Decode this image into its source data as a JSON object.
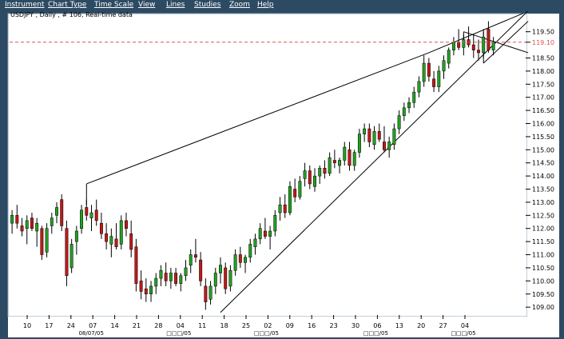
{
  "menu": {
    "items": [
      {
        "label": "Instrument",
        "key": "instrument"
      },
      {
        "label": "Chart Type",
        "key": "chart-type"
      },
      {
        "label": "Time Scale",
        "key": "time-scale"
      },
      {
        "label": "View",
        "key": "view"
      },
      {
        "label": "Lines",
        "key": "lines"
      },
      {
        "label": "Studies",
        "key": "studies"
      },
      {
        "label": "Zoom",
        "key": "zoom"
      },
      {
        "label": "Help",
        "key": "help"
      }
    ]
  },
  "colors": {
    "frame": "#2d4a63",
    "plot_bg": "#ffffff",
    "up_candle": "#22a022",
    "down_candle": "#c01818",
    "wick": "#000000",
    "trendline": "#000000",
    "price_line": "#e05050",
    "grid": "#c8c8c8"
  },
  "chart_data": {
    "type": "candlestick",
    "title": "USDJPY , Daily , # 106, Real-time data",
    "current_price": "119.10",
    "y_ticks": [
      "119.50",
      "119.10",
      "118.50",
      "118.00",
      "117.50",
      "117.00",
      "116.50",
      "116.00",
      "115.50",
      "115.00",
      "114.50",
      "114.00",
      "113.50",
      "113.00",
      "112.50",
      "112.00",
      "111.50",
      "111.00",
      "110.50",
      "110.00",
      "109.50",
      "109.00"
    ],
    "ylim": [
      108.7,
      120.1
    ],
    "x_ticks": [
      "10",
      "17",
      "24",
      "07",
      "14",
      "21",
      "28",
      "04",
      "11",
      "18",
      "25",
      "02",
      "09",
      "16",
      "23",
      "30",
      "06",
      "13",
      "20",
      "27",
      "04"
    ],
    "x_sublabels": [
      {
        "after_tick": 3,
        "label": "08/07/05"
      },
      {
        "after_tick": 7,
        "label": "□□□/05"
      },
      {
        "after_tick": 11,
        "label": "□□□/05"
      },
      {
        "after_tick": 16,
        "label": "□□□/05"
      },
      {
        "after_tick": 20,
        "label": "□□□/05"
      }
    ],
    "candles": [
      [
        112.2,
        112.7,
        111.8,
        112.5
      ],
      [
        112.5,
        112.9,
        112.0,
        112.2
      ],
      [
        112.1,
        112.4,
        111.7,
        111.9
      ],
      [
        112.0,
        112.5,
        111.4,
        112.3
      ],
      [
        112.4,
        112.6,
        111.9,
        112.0
      ],
      [
        111.9,
        112.4,
        111.3,
        112.2
      ],
      [
        112.0,
        112.1,
        110.8,
        111.0
      ],
      [
        111.1,
        112.2,
        110.9,
        112.0
      ],
      [
        112.1,
        112.6,
        111.8,
        112.4
      ],
      [
        112.5,
        113.0,
        112.2,
        112.8
      ],
      [
        113.1,
        113.3,
        111.9,
        112.1
      ],
      [
        112.0,
        112.3,
        109.8,
        110.2
      ],
      [
        110.5,
        111.6,
        110.3,
        111.4
      ],
      [
        111.5,
        112.1,
        111.0,
        111.9
      ],
      [
        112.0,
        112.9,
        111.8,
        112.7
      ],
      [
        112.8,
        113.1,
        112.3,
        112.5
      ],
      [
        112.4,
        112.9,
        111.9,
        112.6
      ],
      [
        112.7,
        113.1,
        112.1,
        112.3
      ],
      [
        112.2,
        112.6,
        111.6,
        111.8
      ],
      [
        111.8,
        112.2,
        111.2,
        111.5
      ],
      [
        111.4,
        112.0,
        110.9,
        111.7
      ],
      [
        111.6,
        112.2,
        111.2,
        111.3
      ],
      [
        111.4,
        112.5,
        111.2,
        112.3
      ],
      [
        112.3,
        112.6,
        111.7,
        112.0
      ],
      [
        111.8,
        112.3,
        110.9,
        111.2
      ],
      [
        111.3,
        111.6,
        109.6,
        109.9
      ],
      [
        110.0,
        110.4,
        109.3,
        109.6
      ],
      [
        109.7,
        110.1,
        109.2,
        109.5
      ],
      [
        109.5,
        110.0,
        109.2,
        109.8
      ],
      [
        109.8,
        110.3,
        109.5,
        110.1
      ],
      [
        110.1,
        110.6,
        109.8,
        110.4
      ],
      [
        110.3,
        110.7,
        109.8,
        110.0
      ],
      [
        110.0,
        110.5,
        109.7,
        110.3
      ],
      [
        110.3,
        110.5,
        109.8,
        109.9
      ],
      [
        109.9,
        110.3,
        109.6,
        110.2
      ],
      [
        110.2,
        110.8,
        110.0,
        110.5
      ],
      [
        110.6,
        111.2,
        110.3,
        111.0
      ],
      [
        111.0,
        111.6,
        110.7,
        110.9
      ],
      [
        110.8,
        111.1,
        109.8,
        110.0
      ],
      [
        109.8,
        110.1,
        108.9,
        109.2
      ],
      [
        109.3,
        110.0,
        109.1,
        109.8
      ],
      [
        109.8,
        110.5,
        109.5,
        110.3
      ],
      [
        110.3,
        110.9,
        109.9,
        110.6
      ],
      [
        110.5,
        110.7,
        109.5,
        109.7
      ],
      [
        109.8,
        110.6,
        109.6,
        110.4
      ],
      [
        110.4,
        111.2,
        110.2,
        111.0
      ],
      [
        111.0,
        111.3,
        110.5,
        110.7
      ],
      [
        110.7,
        111.0,
        110.3,
        110.9
      ],
      [
        110.9,
        111.6,
        110.7,
        111.4
      ],
      [
        111.3,
        111.8,
        111.0,
        111.6
      ],
      [
        111.6,
        112.2,
        111.4,
        112.0
      ],
      [
        111.9,
        112.4,
        111.6,
        111.7
      ],
      [
        111.7,
        112.1,
        111.2,
        111.9
      ],
      [
        111.9,
        112.7,
        111.7,
        112.5
      ],
      [
        112.6,
        113.2,
        112.3,
        112.9
      ],
      [
        112.9,
        113.3,
        112.4,
        112.6
      ],
      [
        112.6,
        113.8,
        112.5,
        113.6
      ],
      [
        113.5,
        113.9,
        113.0,
        113.2
      ],
      [
        113.2,
        114.0,
        113.1,
        113.8
      ],
      [
        113.9,
        114.5,
        113.6,
        114.2
      ],
      [
        114.2,
        114.4,
        113.5,
        113.7
      ],
      [
        113.6,
        114.3,
        113.4,
        114.0
      ],
      [
        114.0,
        114.4,
        113.7,
        114.3
      ],
      [
        114.3,
        114.6,
        113.9,
        114.1
      ],
      [
        114.1,
        114.9,
        114.0,
        114.7
      ],
      [
        114.6,
        115.0,
        114.3,
        114.5
      ],
      [
        114.4,
        114.7,
        114.1,
        114.6
      ],
      [
        114.6,
        115.3,
        114.4,
        115.1
      ],
      [
        115.0,
        115.3,
        114.2,
        114.4
      ],
      [
        114.4,
        115.0,
        114.2,
        114.9
      ],
      [
        114.9,
        115.8,
        114.7,
        115.6
      ],
      [
        115.6,
        116.0,
        115.3,
        115.8
      ],
      [
        115.8,
        116.0,
        115.1,
        115.3
      ],
      [
        115.2,
        115.9,
        115.0,
        115.7
      ],
      [
        115.7,
        116.0,
        115.3,
        115.4
      ],
      [
        115.3,
        115.9,
        114.9,
        115.0
      ],
      [
        115.0,
        115.5,
        114.7,
        115.3
      ],
      [
        115.2,
        116.0,
        115.0,
        115.8
      ],
      [
        115.8,
        116.5,
        115.6,
        116.3
      ],
      [
        116.3,
        116.8,
        116.1,
        116.6
      ],
      [
        116.6,
        117.0,
        116.4,
        116.8
      ],
      [
        116.8,
        117.4,
        116.6,
        117.2
      ],
      [
        117.2,
        117.8,
        117.0,
        117.6
      ],
      [
        117.6,
        118.6,
        117.4,
        118.3
      ],
      [
        118.3,
        118.5,
        117.6,
        117.8
      ],
      [
        117.7,
        118.0,
        117.2,
        117.4
      ],
      [
        117.4,
        118.2,
        117.2,
        118.0
      ],
      [
        118.0,
        118.6,
        117.7,
        118.4
      ],
      [
        118.3,
        118.9,
        118.1,
        118.8
      ],
      [
        118.8,
        119.3,
        118.6,
        119.1
      ],
      [
        119.1,
        119.6,
        118.8,
        118.9
      ],
      [
        118.9,
        119.4,
        118.6,
        119.2
      ],
      [
        119.2,
        119.7,
        118.9,
        119.0
      ],
      [
        119.0,
        119.4,
        118.5,
        118.8
      ],
      [
        118.8,
        119.2,
        118.4,
        118.7
      ],
      [
        118.7,
        119.5,
        118.5,
        119.3
      ],
      [
        119.6,
        119.9,
        118.7,
        118.8
      ],
      [
        118.8,
        119.3,
        118.6,
        119.1
      ]
    ],
    "trendlines": [
      {
        "x1": 15,
        "y1": 113.7,
        "x2": 84,
        "y2": 118.7
      },
      {
        "x1": 84,
        "y1": 118.7,
        "x2": 103,
        "y2": 120.2
      },
      {
        "x1": 15,
        "y1": 113.7,
        "x2": 15,
        "y2": 112.9
      },
      {
        "x1": 42,
        "y1": 108.8,
        "x2": 104,
        "y2": 120.3
      },
      {
        "x1": 91,
        "y1": 119.5,
        "x2": 104,
        "y2": 118.7
      },
      {
        "x1": 91,
        "y1": 119.5,
        "x2": 91,
        "y2": 118.9
      },
      {
        "x1": 95,
        "y1": 118.3,
        "x2": 104,
        "y2": 119.9
      },
      {
        "x1": 95,
        "y1": 119.6,
        "x2": 95,
        "y2": 118.3
      }
    ],
    "grid": false,
    "legend": "none"
  }
}
